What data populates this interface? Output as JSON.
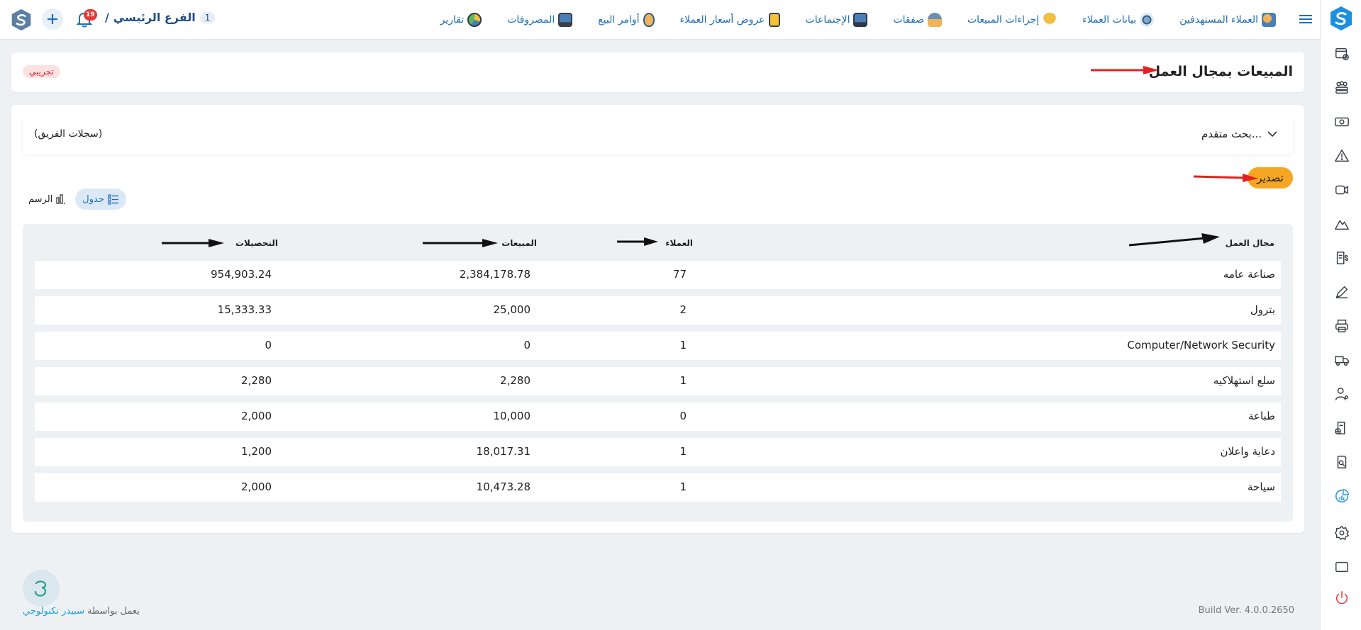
{
  "colors": {
    "accent": "#1e6fb5",
    "export": "#f5a623",
    "badge": "#e53935",
    "annotation_red": "#e32020",
    "annotation_black": "#111111"
  },
  "topbar": {
    "branch_num": "1",
    "branch_name": "الفرع الرئيسي",
    "branch_separator": "/",
    "notification_count": "19",
    "nav": [
      {
        "label": "العملاء المستهدفين",
        "icon": "target-customers-icon"
      },
      {
        "label": "بيانات العملاء",
        "icon": "customer-data-icon"
      },
      {
        "label": "إجراءات المبيعات",
        "icon": "sales-actions-icon"
      },
      {
        "label": "صفقات",
        "icon": "deals-icon"
      },
      {
        "label": "الإجتماعات",
        "icon": "meetings-icon"
      },
      {
        "label": "عروض أسعار العملاء",
        "icon": "quotes-icon"
      },
      {
        "label": "أوامر البيع",
        "icon": "sales-orders-icon"
      },
      {
        "label": "المصروفات",
        "icon": "expenses-icon"
      },
      {
        "label": "تقارير",
        "icon": "reports-icon"
      }
    ]
  },
  "page": {
    "title": "المبيعات بمجال العمل",
    "badge": "تجريبي"
  },
  "search": {
    "label": "بحث متقدم...",
    "team": "(سجلات الفريق)"
  },
  "toolbar": {
    "export_label": "تصدير",
    "table_label": "جدول",
    "chart_label": "الرسم"
  },
  "table": {
    "headers": {
      "field": "مجال العمل",
      "customers": "العملاء",
      "sales": "المبيعات",
      "collections": "التحصيلات"
    },
    "rows": [
      {
        "field": "صناعة عامه",
        "customers": "77",
        "sales": "2,384,178.78",
        "collections": "954,903.24"
      },
      {
        "field": "بترول",
        "customers": "2",
        "sales": "25,000",
        "collections": "15,333.33"
      },
      {
        "field": "Computer/Network Security",
        "customers": "1",
        "sales": "0",
        "collections": "0"
      },
      {
        "field": "سلع استهلاكيه",
        "customers": "1",
        "sales": "2,280",
        "collections": "2,280"
      },
      {
        "field": "طباعة",
        "customers": "0",
        "sales": "10,000",
        "collections": "2,000"
      },
      {
        "field": "دعاية واعلان",
        "customers": "1",
        "sales": "18,017.31",
        "collections": "1,200"
      },
      {
        "field": "سياحة",
        "customers": "1",
        "sales": "10,473.28",
        "collections": "2,000"
      }
    ]
  },
  "footer": {
    "powered_by": "يعمل بواسطة",
    "brand": "سبيدر تكنولوجي",
    "build": "Build Ver. 4.0.0.2650"
  },
  "sidebar": {
    "items": [
      {
        "icon": "report-add-icon"
      },
      {
        "icon": "team-icon"
      },
      {
        "icon": "money-icon"
      },
      {
        "icon": "warning-icon"
      },
      {
        "icon": "video-icon"
      },
      {
        "icon": "mountain-icon"
      },
      {
        "icon": "invoice-dollar-icon"
      },
      {
        "icon": "pen-icon"
      },
      {
        "icon": "printer-icon"
      },
      {
        "icon": "truck-icon"
      },
      {
        "icon": "user-settings-icon"
      },
      {
        "icon": "document-add-icon"
      },
      {
        "icon": "document-search-icon"
      },
      {
        "icon": "chart-report-icon"
      },
      {
        "icon": "gear-icon"
      },
      {
        "icon": "window-icon"
      },
      {
        "icon": "power-icon"
      }
    ]
  }
}
